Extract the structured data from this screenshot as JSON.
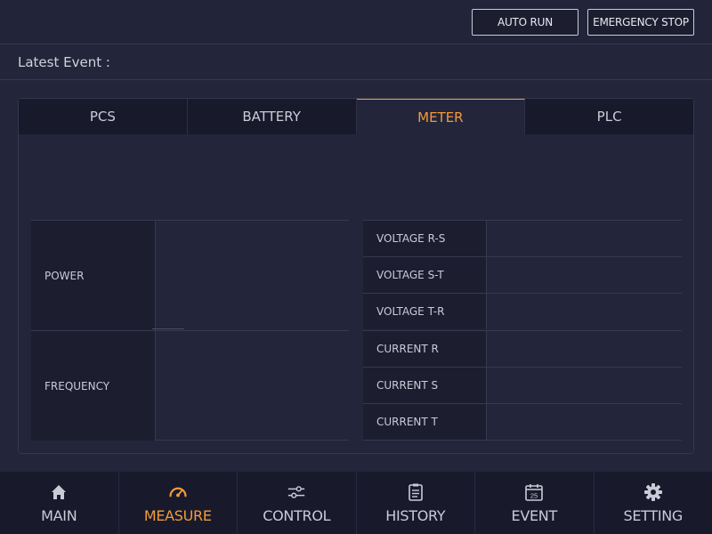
{
  "header": {
    "auto_run_label": "AUTO RUN",
    "emergency_stop_label": "EMERGENCY STOP"
  },
  "event_bar": {
    "label": "Latest Event :"
  },
  "tabs": [
    {
      "label": "PCS",
      "active": false
    },
    {
      "label": "BATTERY",
      "active": false
    },
    {
      "label": "METER",
      "active": true
    },
    {
      "label": "PLC",
      "active": false
    }
  ],
  "meter": {
    "left_rows": [
      {
        "label": "POWER",
        "value": ""
      },
      {
        "label": "FREQUENCY",
        "value": ""
      }
    ],
    "right_rows": [
      {
        "label": "VOLTAGE R-S",
        "value": ""
      },
      {
        "label": "VOLTAGE S-T",
        "value": ""
      },
      {
        "label": "VOLTAGE T-R",
        "value": ""
      },
      {
        "label": "CURRENT R",
        "value": ""
      },
      {
        "label": "CURRENT S",
        "value": ""
      },
      {
        "label": "CURRENT T",
        "value": ""
      }
    ]
  },
  "nav": [
    {
      "label": "MAIN",
      "icon": "home-icon",
      "active": false
    },
    {
      "label": "MEASURE",
      "icon": "gauge-icon",
      "active": true
    },
    {
      "label": "CONTROL",
      "icon": "sliders-icon",
      "active": false
    },
    {
      "label": "HISTORY",
      "icon": "clipboard-icon",
      "active": false
    },
    {
      "label": "EVENT",
      "icon": "calendar-icon",
      "active": false,
      "calendar_day": "25"
    },
    {
      "label": "SETTING",
      "icon": "gear-icon",
      "active": false
    }
  ],
  "colors": {
    "accent": "#f39a3b",
    "background": "#23253a",
    "panel_dark": "#181a2b"
  }
}
